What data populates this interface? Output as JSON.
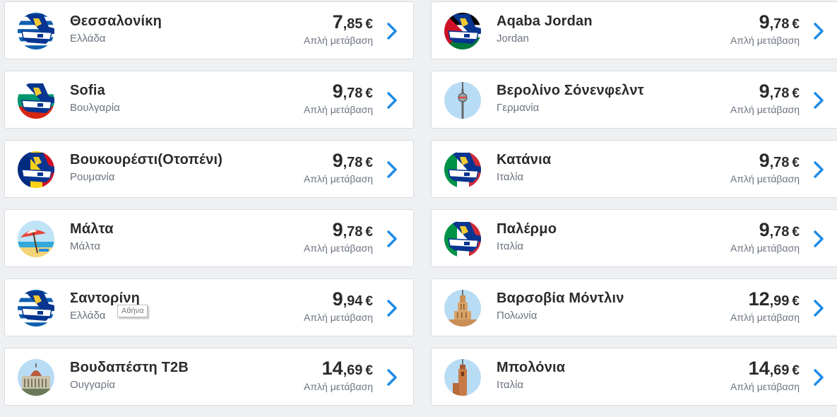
{
  "currency_symbol": "€",
  "left_column": [
    {
      "name": "Θεσσαλονίκη",
      "country": "Ελλάδα",
      "price_int": "7",
      "price_dec": ",85",
      "fare": "Απλή μετάβαση",
      "icon": "greece-flag-plane-icon"
    },
    {
      "name": "Sofia",
      "country": "Βουλγαρία",
      "price_int": "9",
      "price_dec": ",78",
      "fare": "Απλή μετάβαση",
      "icon": "bulgaria-flag-plane-icon"
    },
    {
      "name": "Βουκουρέστι(Οτοπένι)",
      "country": "Ρουμανία",
      "price_int": "9",
      "price_dec": ",78",
      "fare": "Απλή μετάβαση",
      "icon": "romania-flag-plane-icon"
    },
    {
      "name": "Μάλτα",
      "country": "Μάλτα",
      "price_int": "9",
      "price_dec": ",78",
      "fare": "Απλή μετάβαση",
      "icon": "beach-umbrella-icon"
    },
    {
      "name": "Σαντορίνη",
      "country": "Ελλάδα",
      "price_int": "9",
      "price_dec": ",94",
      "fare": "Απλή μετάβαση",
      "icon": "greece-flag-plane-icon"
    },
    {
      "name": "Βουδαπέστη T2B",
      "country": "Ουγγαρία",
      "price_int": "14",
      "price_dec": ",69",
      "fare": "Απλή μετάβαση",
      "icon": "parliament-building-icon"
    }
  ],
  "right_column": [
    {
      "name": "Aqaba Jordan",
      "country": "Jordan",
      "price_int": "9",
      "price_dec": ",78",
      "fare": "Απλή μετάβαση",
      "icon": "jordan-flag-plane-icon"
    },
    {
      "name": "Βερολίνο Σόνενφελντ",
      "country": "Γερμανία",
      "price_int": "9",
      "price_dec": ",78",
      "fare": "Απλή μετάβαση",
      "icon": "tv-tower-icon"
    },
    {
      "name": "Κατάνια",
      "country": "Ιταλία",
      "price_int": "9",
      "price_dec": ",78",
      "fare": "Απλή μετάβαση",
      "icon": "italy-flag-plane-icon"
    },
    {
      "name": "Παλέρμο",
      "country": "Ιταλία",
      "price_int": "9",
      "price_dec": ",78",
      "fare": "Απλή μετάβαση",
      "icon": "italy-flag-plane-icon"
    },
    {
      "name": "Βαρσοβία Μόντλιν",
      "country": "Πολωνία",
      "price_int": "12",
      "price_dec": ",99",
      "fare": "Απλή μετάβαση",
      "icon": "palace-of-culture-icon"
    },
    {
      "name": "Μπολόνια",
      "country": "Ιταλία",
      "price_int": "14",
      "price_dec": ",69",
      "fare": "Απλή μετάβαση",
      "icon": "medieval-tower-icon"
    }
  ],
  "tooltip": {
    "text": "Αθήνα"
  },
  "colors": {
    "accent": "#1f8ce6",
    "text_dark": "#2b2b2b",
    "text_muted": "#6c7480",
    "card_border": "#d7dbe0",
    "background": "#eef0f2",
    "plane_navy": "#073590"
  }
}
